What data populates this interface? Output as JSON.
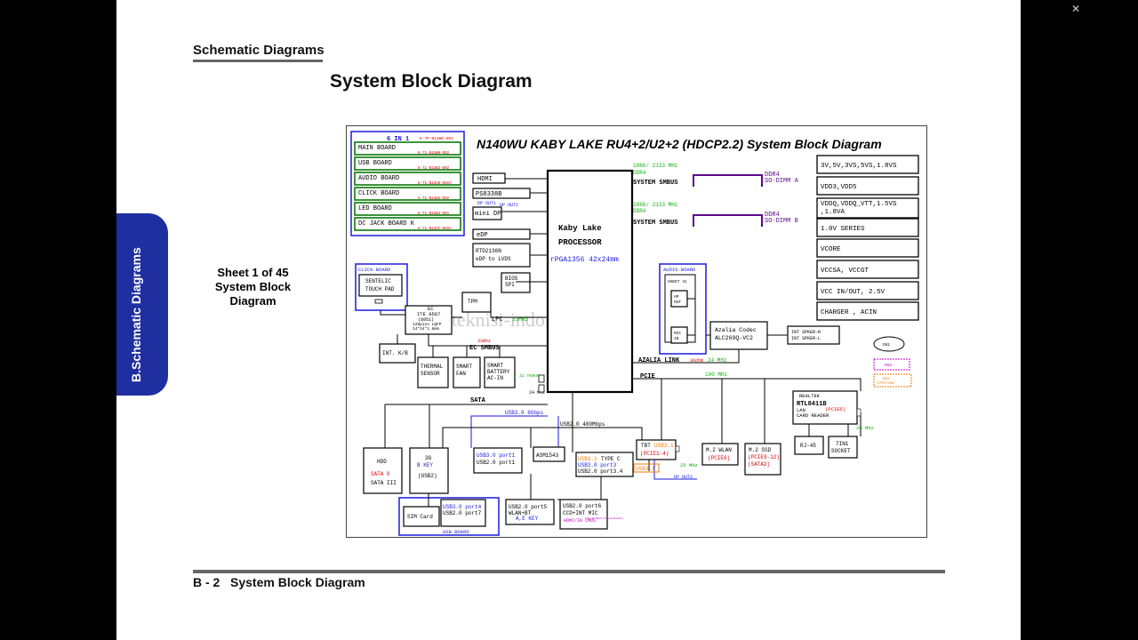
{
  "header": {
    "section_title": "Schematic  Diagrams",
    "page_title": "System Block Diagram"
  },
  "side_tab": {
    "label": "B.Schematic Diagrams"
  },
  "sheet_info": {
    "line1": "Sheet 1 of 45",
    "line2": "System Block",
    "line3": "Diagram"
  },
  "footer": {
    "page_number": "B - 2",
    "page_label": "System Block Diagram"
  },
  "viewer": {
    "exit_fullscreen_icon": "exit-fullscreen-icon"
  },
  "diagram": {
    "title": "N140WU KABY LAKE RU4+2/U2+2 (HDCP2.2) System Block Diagram",
    "watermark": "www.teknisi-indonesia.com",
    "boards": {
      "heading": "6  IN  1",
      "heading_pn": "6-7P-N13W6-D02",
      "items": [
        {
          "label": "MAIN BOARD",
          "pn": "6-71-N13W0-D02"
        },
        {
          "label": "USB BOARD",
          "pn": "6-71-N13W3-D02"
        },
        {
          "label": "AUDIO BOARD",
          "pn": "6-71-N13U8-D02A"
        },
        {
          "label": "CLICK BOARD",
          "pn": "6-71-N13W2-D02"
        },
        {
          "label": "LED BOARD",
          "pn": "6-71-N13W4-D01"
        },
        {
          "label": "DC JACK BOARD K",
          "pn": "6-71-N13UC-D02A"
        }
      ]
    },
    "cpu": {
      "line1": "Kaby Lake",
      "line2": "PROCESSOR",
      "package": "rPGA1356  42x24mm"
    },
    "ddr": [
      {
        "speed": "1866/ 2133 MHz",
        "type": "DDR4",
        "smbus": "SYSTEM  SMBUS",
        "slot_type": "DDR4",
        "slot": "SO-DIMM  A"
      },
      {
        "speed": "1866/ 2133 MHz",
        "type": "DDR4",
        "smbus": "SYSTEM  SMBUS",
        "slot_type": "DDR4",
        "slot": "SO-DIMM  B"
      }
    ],
    "power_rails": [
      "3V,5V,3VS,5VS,1.8VS",
      "VDD3,VDD5",
      "VDDQ,VDDQ_VTT,1.5VS",
      ",1.8VA",
      "1.0V SERIES",
      "VCORE",
      "VCCSA,  VCCGT",
      "VCC IN/OUT, 2.5V",
      "CHARGER  ,  ACIN"
    ],
    "display": {
      "hdmi": "HDMI",
      "ps8338b": "PS8338B",
      "dp_out1": "DP OUT1",
      "dp_out2": "DP OUT2",
      "mini_dp": "mini DP",
      "edp": "eDP",
      "rtd_line1": "RTD2136N",
      "rtd_line2": "eDP to LVDS"
    },
    "left": {
      "click_board": "CLICK  BOARD",
      "touchpad_line1": "SENTELIC",
      "touchpad_line2": "TOUCH PAD",
      "bios_line1": "BIOS",
      "bios_line2": "SPI",
      "tpm": "TPM",
      "ec_line1": "EC",
      "ec_line2": "ITE  8587",
      "ec_line3": "(8951)",
      "ec_line4": "128pins  LQFP",
      "ec_line5": "14*14*1.6mm",
      "lpc": "LPC",
      "lpc_speed": "33MHz",
      "ec_smbus": "EC  SMBUS",
      "ec_smbus_speed": "33mhz",
      "kb": "INT. K/B",
      "thermal_line1": "THERMAL",
      "thermal_line2": "SENSOR",
      "fan_line1": "SMART",
      "fan_line2": "FAN",
      "batt_line1": "SMART",
      "batt_line2": "BATTERY",
      "batt_line3": "AC-IN",
      "clk_a": "32.768KHz",
      "clk_b": "24 MHz"
    },
    "audio": {
      "board_label": "AUDIO  BOARD",
      "sheet": "SHEET 41",
      "hp_line1": "HP",
      "hp_line2": "OUT",
      "mic_line1": "MIC",
      "mic_line2": "IN",
      "codec_line1": "Azalia  Codec",
      "codec_line2": "ALC269Q-VC2",
      "spk_r": "INT  SPKER-R",
      "spk_l": "INT  SPKER-L",
      "link": "AZALIA  LINK",
      "link_note": "36ohm",
      "link_speed": "24 MHz",
      "d_circle": "D61",
      "d_pink": "D62",
      "d_orange_line1": "D63",
      "d_orange_line2": "D+PVT+MHZ"
    },
    "pcie": {
      "label": "PCIE",
      "speed": "100 MHz",
      "tbt": "TBT",
      "tbt_usb": "USB3.1",
      "tbt_pcie": "(PCIE1-4)",
      "tbt_usb_out": "USB3.1",
      "tbt_clk": "25 MHz",
      "dp_out": "DP OUT2",
      "wlan_line1": "M.2 WLAN",
      "wlan_line2": "(PCIE6)",
      "ssd_line1": "M.2 SSD",
      "ssd_line2": "(PCIE9-12)",
      "ssd_line3": "(SATA2)",
      "lan_line1": "REALTEK",
      "lan_line2": "RTL8411B",
      "lan_line3": "LAN",
      "lan_line4": "(PCIE5)",
      "lan_line5": "CARD  READER",
      "lan_clk": "25 MHz",
      "rj45": "RJ-45",
      "socket_line1": "7IN1",
      "socket_line2": "SOCKET"
    },
    "bottom": {
      "sata": "SATA",
      "usb30": "USB3.0  6Gbps",
      "usb20": "USB2.0  480Mbps",
      "hdd": "HDD",
      "hdd_sata_a": "SATA 0",
      "hdd_sata_b": "SATA III",
      "g3": "3G",
      "g3_key": "B KEY",
      "g3_bus": "(USB2)",
      "sim": "SIM Card",
      "usb_port1_a": "USB3.0  port1",
      "usb_port1_b": "USB2.0  port1",
      "usb_port4_a": "USB3.0  port4",
      "usb_port4_b": "USB2.0  port7",
      "usb_board": "USB  BOARD",
      "asm": "ASM1543",
      "typec_a": "USB3.1",
      "typec_b": "TYPE C",
      "typec_c": "USB3.0  port3",
      "typec_d": "USB2.0  port3.4",
      "wlan_bt_a": "USB2.0  port5",
      "wlan_bt_b": "WLAN+BT",
      "wlan_bt_c": "A,E KEY",
      "ccd_a": "USB2.0  port6",
      "ccd_b": "CCD+INT  MIC",
      "ccd_c": "HDMI/IR  CMOS",
      "ccd_d": "ToF-30/30fs/Hu+Cw/MemFly"
    }
  }
}
